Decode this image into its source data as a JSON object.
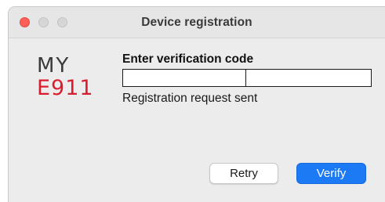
{
  "window": {
    "title": "Device registration"
  },
  "logo": {
    "line1": "MY",
    "line2": "E911",
    "accent_color": "#d81e2e"
  },
  "form": {
    "heading": "Enter verification code",
    "code_part_1": "",
    "code_part_2": "",
    "status_text": "Registration request sent"
  },
  "buttons": {
    "retry_label": "Retry",
    "verify_label": "Verify",
    "verify_color": "#1c7af5"
  },
  "icons": {
    "close": "close-icon",
    "minimize": "minimize-icon",
    "maximize": "maximize-icon"
  }
}
